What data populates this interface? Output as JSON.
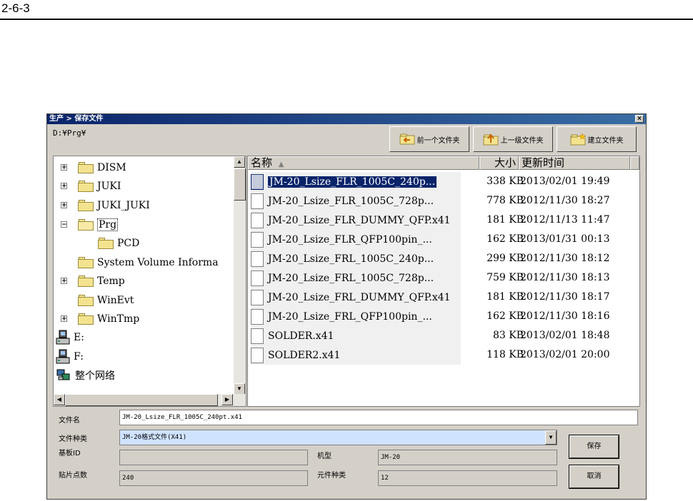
{
  "page": {
    "heading": "2-6-3"
  },
  "dialog": {
    "title": "生产 > 保存文件",
    "close_glyph": "×",
    "current_path": "D:¥Prg¥",
    "toolbar": {
      "back_label": "前一个文件夹",
      "up_label": "上一级文件夹",
      "new_folder_label": "建立文件夹"
    }
  },
  "tree": {
    "items": [
      {
        "label": "DISM",
        "expander": "+"
      },
      {
        "label": "JUKI",
        "expander": "+"
      },
      {
        "label": "JUKI_JUKI",
        "expander": "+"
      },
      {
        "label": "Prg",
        "expander": "−"
      },
      {
        "label": "PCD",
        "expander": ""
      },
      {
        "label": "System Volume Informa",
        "expander": ""
      },
      {
        "label": "Temp",
        "expander": "+"
      },
      {
        "label": "WinEvt",
        "expander": ""
      },
      {
        "label": "WinTmp",
        "expander": "+"
      },
      {
        "label": "E:",
        "expander": ""
      },
      {
        "label": "F:",
        "expander": ""
      },
      {
        "label": "整个网络",
        "expander": ""
      }
    ]
  },
  "file_list": {
    "columns": {
      "name": "名称",
      "sort_glyph": "▲",
      "size": "大小",
      "date": "更新时间"
    },
    "rows": [
      {
        "name": "JM-20_Lsize_FLR_1005C_240p...",
        "size": "338 KB",
        "date": "2013/02/01 19:49",
        "selected": true
      },
      {
        "name": "JM-20_Lsize_FLR_1005C_728p...",
        "size": "778 KB",
        "date": "2012/11/30 18:27"
      },
      {
        "name": "JM-20_Lsize_FLR_DUMMY_QFP.x41",
        "size": "181 KB",
        "date": "2012/11/13 11:47"
      },
      {
        "name": "JM-20_Lsize_FLR_QFP100pin_...",
        "size": "162 KB",
        "date": "2013/01/31 00:13"
      },
      {
        "name": "JM-20_Lsize_FRL_1005C_240p...",
        "size": "299 KB",
        "date": "2012/11/30 18:12"
      },
      {
        "name": "JM-20_Lsize_FRL_1005C_728p...",
        "size": "759 KB",
        "date": "2012/11/30 18:13"
      },
      {
        "name": "JM-20_Lsize_FRL_DUMMY_QFP.x41",
        "size": "181 KB",
        "date": "2012/11/30 18:17"
      },
      {
        "name": "JM-20_Lsize_FRL_QFP100pin_...",
        "size": "162 KB",
        "date": "2012/11/30 18:16"
      },
      {
        "name": "SOLDER.x41",
        "size": "83 KB",
        "date": "2013/02/01 18:48"
      },
      {
        "name": "SOLDER2.x41",
        "size": "118 KB",
        "date": "2013/02/01 20:00"
      }
    ]
  },
  "form": {
    "filename_label": "文件名",
    "filename_value": "JM-20_Lsize_FLR_1005C_240pt.x41",
    "filetype_label": "文件种类",
    "filetype_value": "JM-20格式文件(X41)",
    "board_id_label": "基板ID",
    "board_id_value": "",
    "model_label": "机型",
    "model_value": "JM-20",
    "points_label": "贴片点数",
    "points_value": "240",
    "part_types_label": "元件种类",
    "part_types_value": "12",
    "save_label": "保存",
    "cancel_label": "取消"
  },
  "colors": {
    "title_bar": "#0a246a",
    "selection": "#0a246a",
    "dialog_bg": "#d4d0c8",
    "folder": "#f4e38e",
    "combo_bg": "#cfe3ff"
  }
}
